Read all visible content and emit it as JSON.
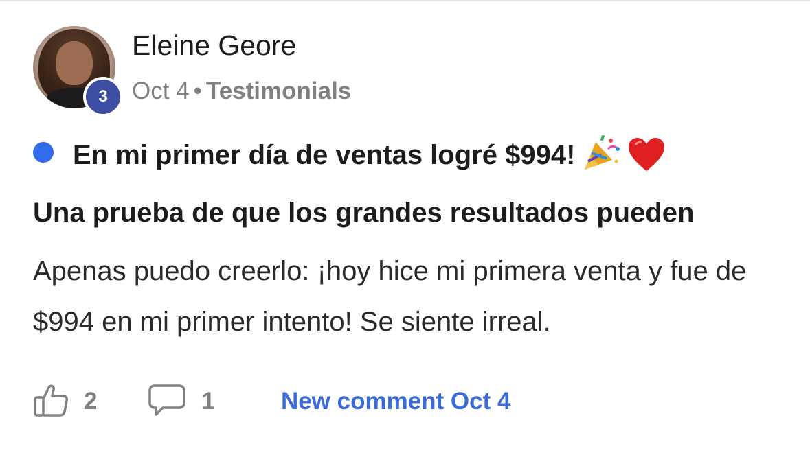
{
  "post": {
    "author": "Eleine Geore",
    "avatar_badge": "3",
    "date": "Oct 4",
    "separator": "•",
    "category": "Testimonials",
    "title_line1": "En mi primer día de ventas logré $994!",
    "title_line2": "Una prueba de que los grandes resultados pueden",
    "body": "Apenas puedo creerlo: ¡hoy hice mi primera venta y fue de $994 en mi primer intento! Se siente irreal.",
    "unread_dot_color": "#2f6bea"
  },
  "footer": {
    "like_count": "2",
    "comment_count": "1",
    "new_comment_label": "New comment Oct 4",
    "link_color": "#3a6bd6"
  },
  "icons": [
    "party-popper-icon",
    "red-heart-icon",
    "thumbs-up-icon",
    "comment-bubble-icon"
  ]
}
